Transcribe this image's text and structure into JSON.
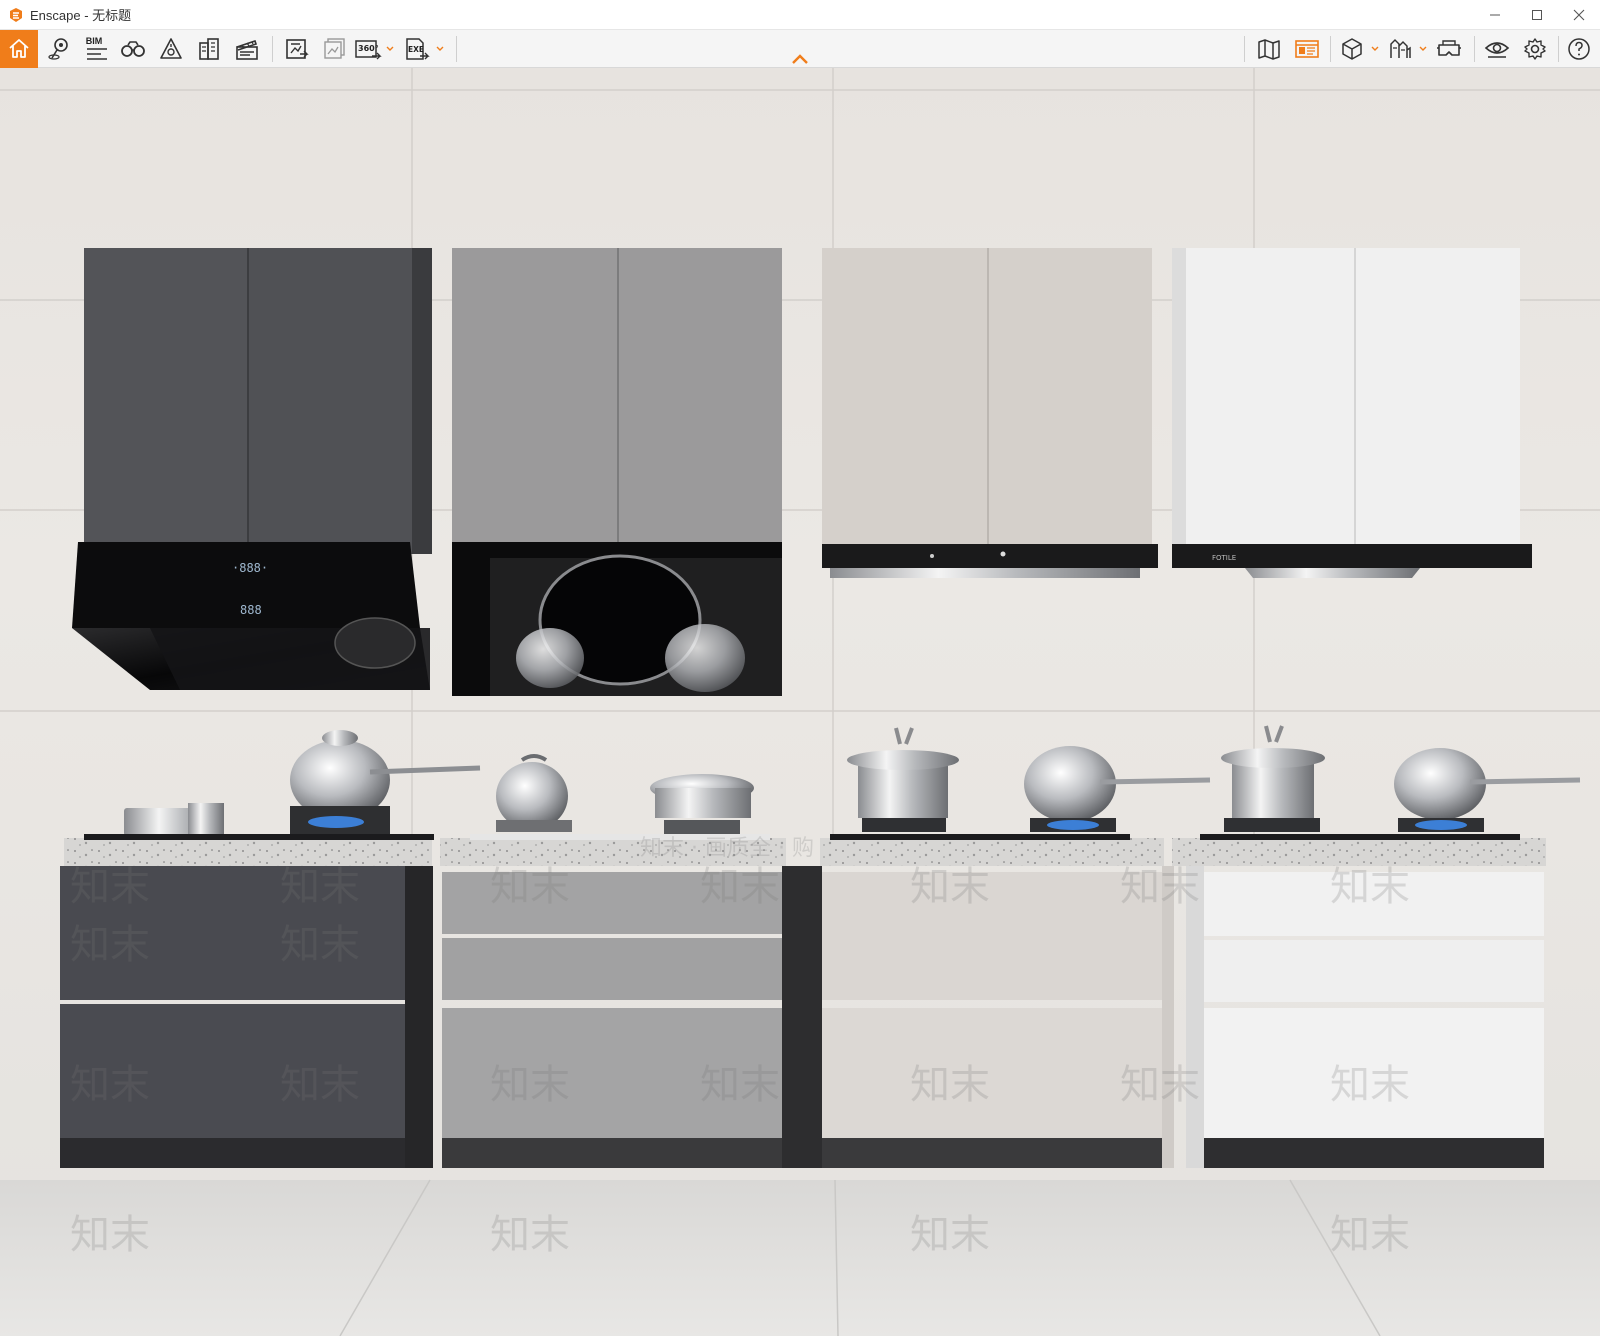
{
  "window": {
    "app_name": "Enscape",
    "separator": " - ",
    "document_title": "无标题",
    "brand_color": "#f07d1a"
  },
  "toolbar": {
    "left_tools": [
      {
        "name": "home-icon",
        "active": true
      },
      {
        "name": "location-icon"
      },
      {
        "name": "bim-icon",
        "label": "BIM"
      },
      {
        "name": "binoculars-icon"
      },
      {
        "name": "atmosphere-icon"
      },
      {
        "name": "buildings-icon"
      },
      {
        "name": "clapper-icon"
      }
    ],
    "export_tools": [
      {
        "name": "screenshot-icon"
      },
      {
        "name": "batch-render-icon"
      },
      {
        "name": "panorama-360-icon",
        "label": "360°"
      },
      {
        "name": "exe-export-icon",
        "label": "EXE"
      }
    ],
    "right_tools": [
      {
        "name": "map-icon"
      },
      {
        "name": "material-editor-icon",
        "active": true
      },
      {
        "name": "asset-cube-icon"
      },
      {
        "name": "asset-library-icon"
      },
      {
        "name": "vr-headset-icon"
      },
      {
        "name": "visual-settings-eye-icon"
      },
      {
        "name": "settings-gear-icon"
      },
      {
        "name": "help-icon"
      }
    ]
  },
  "scene": {
    "watermark": "知末",
    "watermark_banner": "知末 · 画质全 · 购",
    "kitchen_units": [
      {
        "color": "dark-graphite",
        "hex": "#4a4b50",
        "hood": "slanted-black-glass"
      },
      {
        "color": "mid-grey",
        "hex": "#9a9a9b",
        "hood": "black-glass-window"
      },
      {
        "color": "warm-beige",
        "hex": "#d9d5d1",
        "hood": "slim-black-panel"
      },
      {
        "color": "white",
        "hex": "#efefef",
        "hood": "slim-black-panel"
      }
    ]
  }
}
